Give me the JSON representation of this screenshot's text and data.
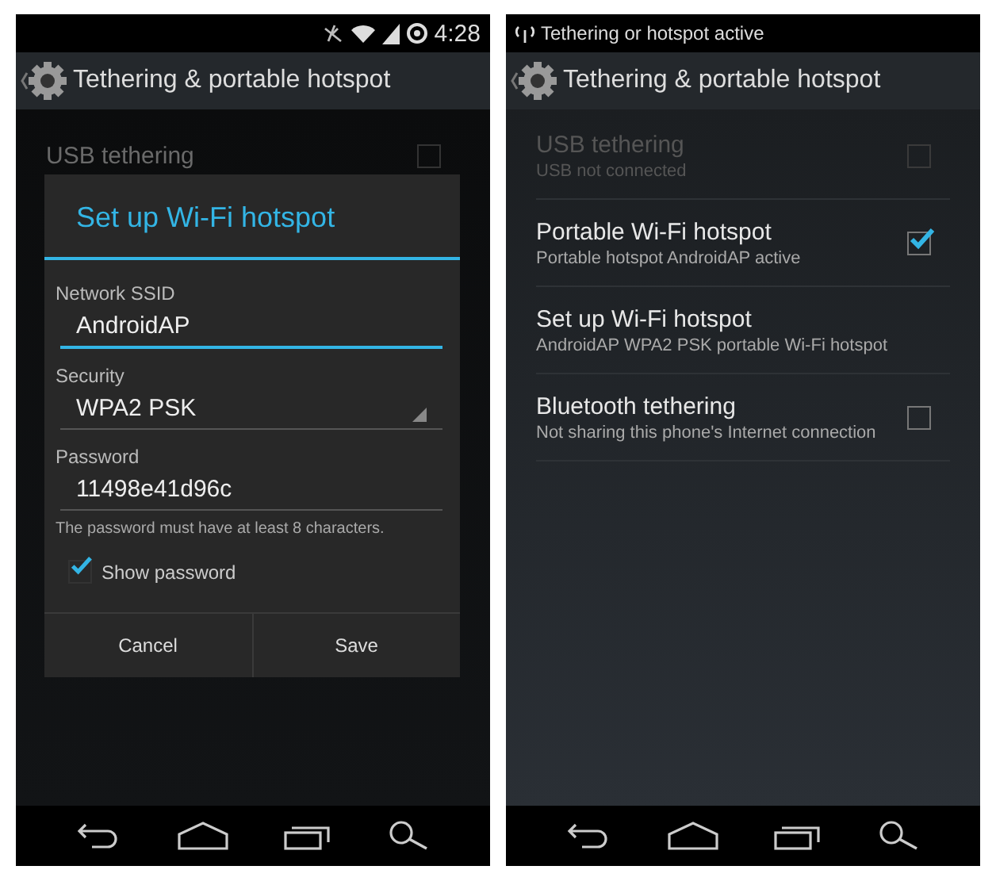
{
  "screens": [
    {
      "status_bar": {
        "kind": "clock",
        "time": "4:28"
      },
      "action_bar": {
        "title": "Tethering & portable hotspot"
      },
      "dimmed": true,
      "list": [
        {
          "kind": "toggle",
          "title": "USB tethering",
          "checked": false,
          "disabled": true
        }
      ],
      "dialog": {
        "title": "Set up Wi-Fi hotspot",
        "fields": [
          {
            "kind": "text",
            "label": "Network SSID",
            "value": "AndroidAP",
            "focused": true
          },
          {
            "kind": "select",
            "label": "Security",
            "value": "WPA2 PSK",
            "focused": false
          },
          {
            "kind": "text",
            "label": "Password",
            "value": "11498e41d96c",
            "focused": false
          }
        ],
        "hint": "The password must have at least 8 characters.",
        "checkbox": {
          "label": "Show password",
          "checked": true
        },
        "buttons": [
          "Cancel",
          "Save"
        ]
      }
    },
    {
      "status_bar": {
        "kind": "notification",
        "text": "Tethering or hotspot active"
      },
      "action_bar": {
        "title": "Tethering & portable hotspot"
      },
      "dimmed": false,
      "list": [
        {
          "kind": "toggle",
          "title": "USB tethering",
          "subtitle": "USB not connected",
          "checked": false,
          "disabled": true
        },
        {
          "kind": "toggle",
          "title": "Portable Wi-Fi hotspot",
          "subtitle": "Portable hotspot AndroidAP active",
          "checked": true,
          "disabled": false
        },
        {
          "kind": "action",
          "title": "Set up Wi-Fi hotspot",
          "subtitle": "AndroidAP WPA2 PSK portable Wi-Fi hotspot",
          "disabled": false
        },
        {
          "kind": "toggle",
          "title": "Bluetooth tethering",
          "subtitle": "Not sharing this phone's Internet connection",
          "checked": false,
          "disabled": false
        }
      ]
    }
  ]
}
